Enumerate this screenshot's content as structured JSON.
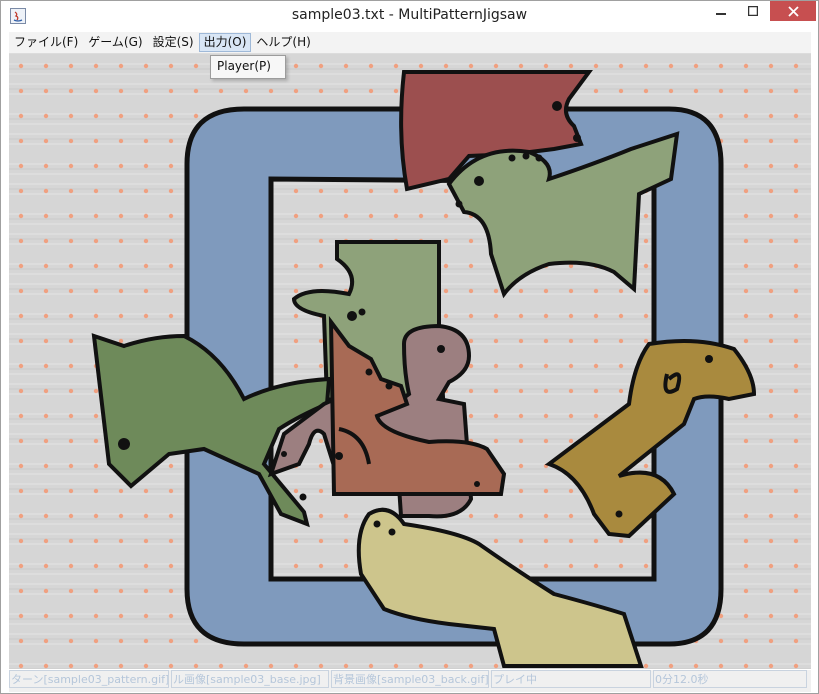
{
  "window": {
    "title": "sample03.txt - MultiPatternJigsaw"
  },
  "menubar": {
    "items": [
      {
        "label": "ファイル(F)"
      },
      {
        "label": "ゲーム(G)"
      },
      {
        "label": "設定(S)"
      },
      {
        "label": "出力(O)"
      },
      {
        "label": "ヘルプ(H)"
      }
    ],
    "active_index": 3
  },
  "dropdown": {
    "items": [
      {
        "label": "Player(P)"
      }
    ]
  },
  "statusbar": {
    "pattern": "ターン[sample03_pattern.gif]",
    "base": "ル画像[sample03_base.jpg]",
    "back": "背景画像[sample03_back.gif]",
    "state": "プレイ中",
    "time": "0分12.0秒"
  },
  "colors": {
    "frame_blue": "#7f9abd",
    "red_piece": "#9c4f4f",
    "sage_piece": "#8ea27a",
    "green_piece": "#6e8a5a",
    "mauve_piece": "#9c7f80",
    "rust_piece": "#a86a55",
    "olive_piece": "#a98a3e",
    "cream_piece": "#cdc58c",
    "close_red": "#c74f50"
  }
}
